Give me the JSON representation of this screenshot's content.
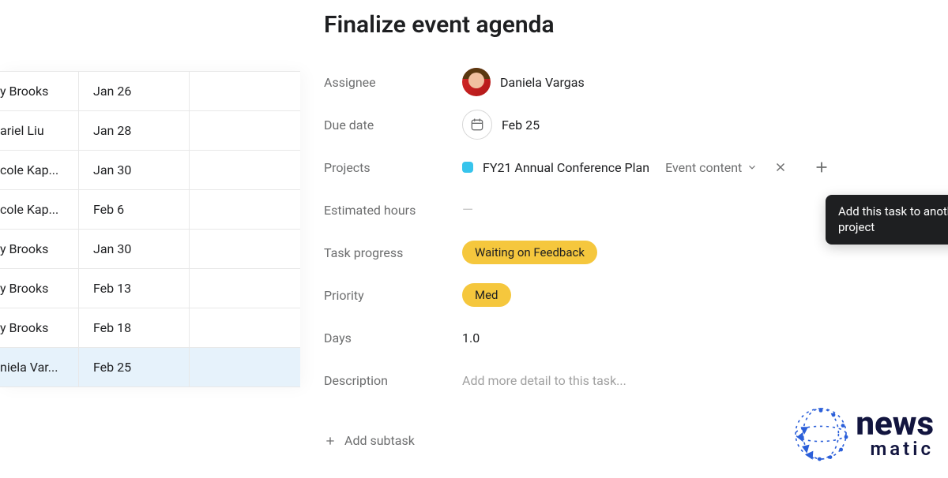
{
  "task": {
    "title": "Finalize event agenda",
    "assignee_label": "Assignee",
    "assignee_name": "Daniela Vargas",
    "due_date_label": "Due date",
    "due_date_value": "Feb 25",
    "projects_label": "Projects",
    "project_name": "FY21 Annual Conference Plan",
    "project_section": "Event content",
    "estimated_hours_label": "Estimated hours",
    "estimated_hours_value": "—",
    "progress_label": "Task progress",
    "progress_value": "Waiting on Feedback",
    "priority_label": "Priority",
    "priority_value": "Med",
    "days_label": "Days",
    "days_value": "1.0",
    "description_label": "Description",
    "description_placeholder": "Add more detail to this task...",
    "add_subtask_label": "Add subtask"
  },
  "tooltip_text": "Add this task to another project",
  "colors": {
    "project_chip": "#37c4ec",
    "badge": "#f5c73d"
  },
  "table_rows": [
    {
      "name": "y Brooks",
      "date": "Jan 26",
      "selected": false
    },
    {
      "name": "ariel Liu",
      "date": "Jan 28",
      "selected": false
    },
    {
      "name": "cole Kap...",
      "date": "Jan 30",
      "selected": false
    },
    {
      "name": "cole Kap...",
      "date": "Feb 6",
      "selected": false
    },
    {
      "name": "y Brooks",
      "date": "Jan 30",
      "selected": false
    },
    {
      "name": "y Brooks",
      "date": "Feb 13",
      "selected": false
    },
    {
      "name": "y Brooks",
      "date": "Feb 18",
      "selected": false
    },
    {
      "name": "niela Var...",
      "date": "Feb 25",
      "selected": true
    }
  ],
  "watermark": {
    "line1": "news",
    "line2": "matic"
  }
}
